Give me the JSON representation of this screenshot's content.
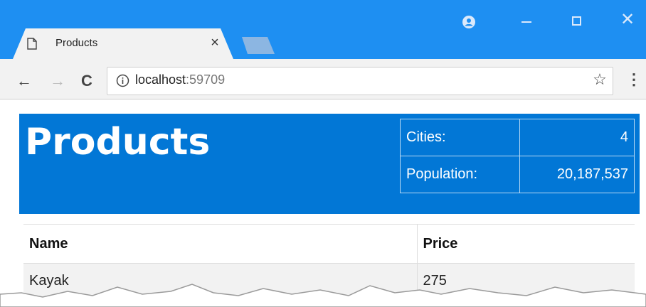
{
  "browser": {
    "tab": {
      "title": "Products",
      "close_glyph": "×"
    },
    "window_controls": {
      "minimize": "minimize-icon",
      "maximize": "maximize-icon",
      "close_glyph": "✕"
    },
    "toolbar": {
      "back_glyph": "←",
      "forward_glyph": "→",
      "reload_glyph": "C",
      "url_host": "localhost",
      "url_port": ":59709",
      "bookmark_glyph": "☆",
      "menu_glyph": "⋮"
    },
    "colors": {
      "titlebar": "#1e8ff2",
      "tab": "#f2f2f2"
    }
  },
  "page": {
    "title": "Products",
    "banner_color": "#0277d6",
    "stats": [
      {
        "label": "Cities:",
        "value": "4"
      },
      {
        "label": "Population:",
        "value": "20,187,537"
      }
    ],
    "table": {
      "headers": {
        "name": "Name",
        "price": "Price"
      },
      "rows": [
        {
          "name": "Kayak",
          "price": "275"
        }
      ]
    }
  }
}
